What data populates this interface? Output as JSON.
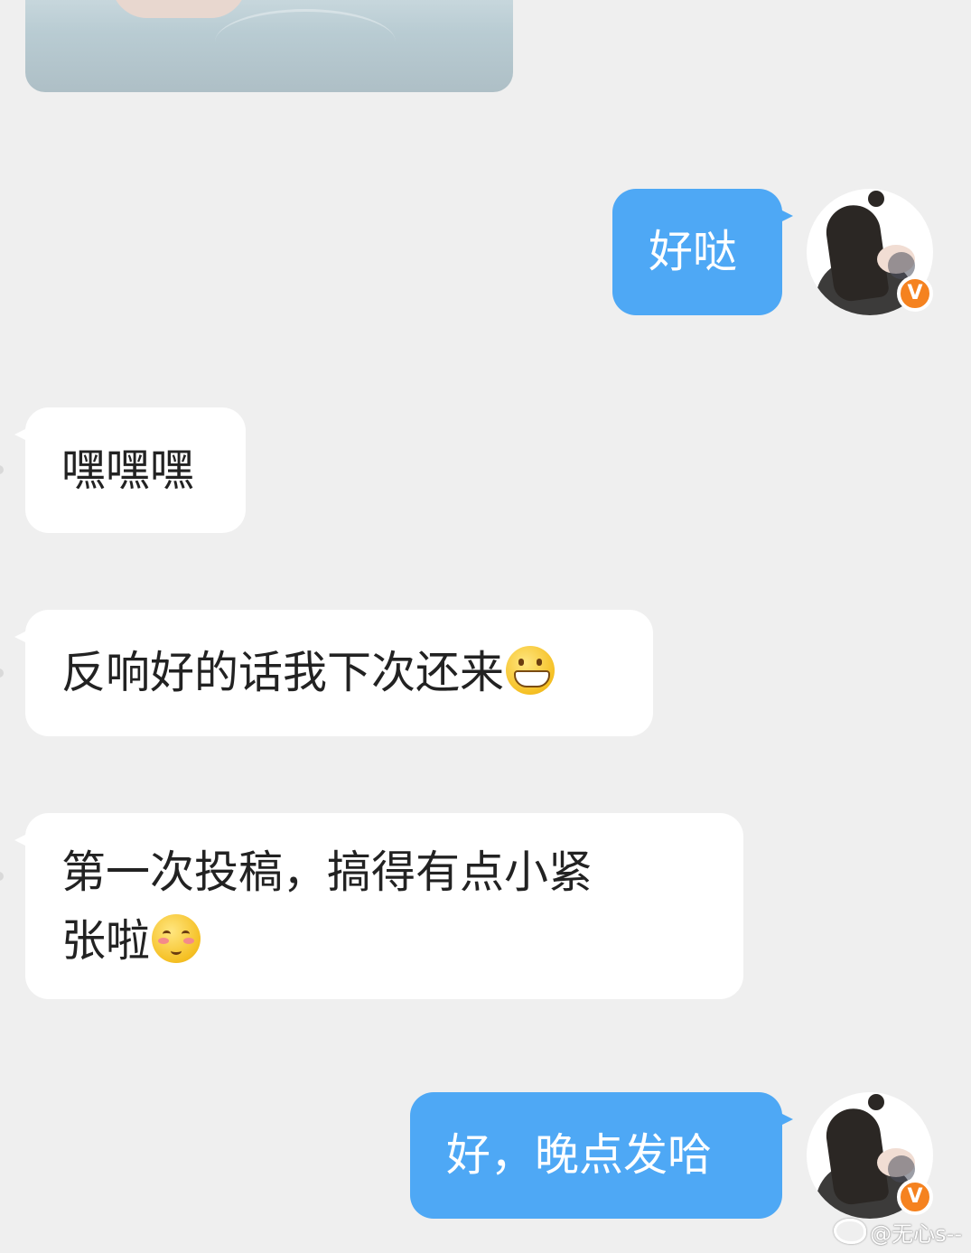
{
  "conversation": {
    "messages": [
      {
        "side": "out",
        "text": "好哒"
      },
      {
        "side": "in",
        "text": "嘿嘿嘿"
      },
      {
        "side": "in",
        "text": "反响好的话我下次还来",
        "emoji": "grin-emoji"
      },
      {
        "side": "in",
        "line1": "第一次投稿，搞得有点小紧",
        "line2": "张啦",
        "emoji": "shy-emoji"
      },
      {
        "side": "out",
        "text": "好，晚点发哈"
      }
    ],
    "avatar_badge": "V"
  },
  "watermark": {
    "text": "@无心s--"
  },
  "colors": {
    "background": "#efefef",
    "outgoing_bubble": "#4ea8f5",
    "incoming_bubble": "#ffffff",
    "badge": "#f5821f"
  }
}
